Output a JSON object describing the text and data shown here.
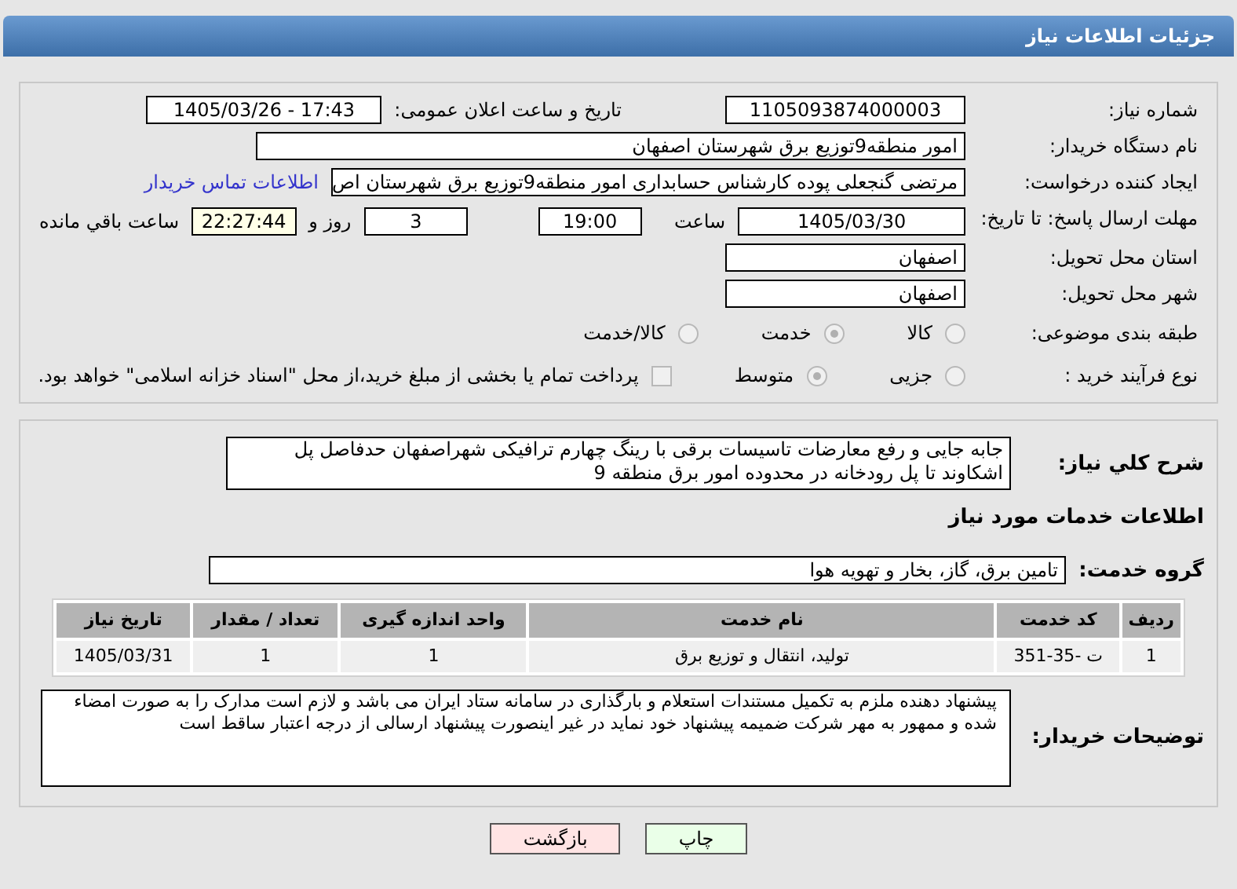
{
  "header": {
    "title": "جزئیات اطلاعات نیاز"
  },
  "need_number": {
    "label": "شماره نیاز:",
    "value": "1105093874000003"
  },
  "announce": {
    "label": "تاریخ و ساعت اعلان عمومی:",
    "value": "1405/03/26 - 17:43"
  },
  "buyer": {
    "label": "نام دستگاه خریدار:",
    "value": "امور منطقه9توزیع برق شهرستان اصفهان"
  },
  "creator": {
    "label": "ایجاد کننده درخواست:",
    "value": "مرتضی گنجعلی پوده کارشناس حسابداری  امور منطقه9توزیع برق شهرستان اص",
    "link": "اطلاعات تماس خریدار"
  },
  "deadline": {
    "label": "مهلت ارسال پاسخ: تا تاریخ:",
    "date": "1405/03/30",
    "time_label": "ساعت",
    "time": "19:00",
    "days": "3",
    "days_label": "روز و",
    "remaining": "22:27:44",
    "remaining_label": "ساعت باقي مانده"
  },
  "province": {
    "label": "استان محل تحویل:",
    "value": "اصفهان"
  },
  "city": {
    "label": "شهر محل تحویل:",
    "value": "اصفهان"
  },
  "category": {
    "label": "طبقه بندی موضوعی:",
    "options": [
      {
        "label": "کالا",
        "selected": false
      },
      {
        "label": "خدمت",
        "selected": true
      },
      {
        "label": "کالا/خدمت",
        "selected": false
      }
    ]
  },
  "process": {
    "label": "نوع فرآیند خرید :",
    "options": [
      {
        "label": "جزیی",
        "selected": false
      },
      {
        "label": "متوسط",
        "selected": true
      }
    ],
    "treasury": {
      "label": "پرداخت تمام یا بخشی از مبلغ خرید،از محل \"اسناد خزانه اسلامی\" خواهد بود.",
      "checked": false
    }
  },
  "description": {
    "label": "شرح کلي نياز:",
    "value": "جابه جایی و رفع معارضات تاسیسات برقی با رینگ چهارم ترافیکی شهراصفهان حدفاصل پل اشکاوند تا پل رودخانه در محدوده امور برق منطقه 9"
  },
  "services_title": "اطلاعات خدمات مورد نیاز",
  "service_group": {
    "label": "گروه خدمت:",
    "value": "تامین برق، گاز، بخار و تهویه هوا"
  },
  "table": {
    "columns": [
      "ردیف",
      "کد خدمت",
      "نام خدمت",
      "واحد اندازه گیری",
      "تعداد / مقدار",
      "تاریخ نیاز"
    ],
    "rows": [
      [
        "1",
        "ت -35-351",
        "تولید، انتقال و توزیع برق",
        "1",
        "1",
        "1405/03/31"
      ]
    ]
  },
  "buyer_notes": {
    "label": "توضیحات خریدار:",
    "value": "پیشنهاد دهنده ملزم به تکمیل مستندات استعلام و بارگذاری در سامانه ستاد ایران می باشد و لازم است مدارک را به صورت امضاء شده و ممهور به مهر شرکت ضمیمه پیشنهاد خود نماید در غیر اینصورت پیشنهاد ارسالی از درجه اعتبار ساقط است"
  },
  "buttons": [
    {
      "label": "چاپ",
      "kind": "print"
    },
    {
      "label": "بازگشت",
      "kind": "back"
    }
  ]
}
